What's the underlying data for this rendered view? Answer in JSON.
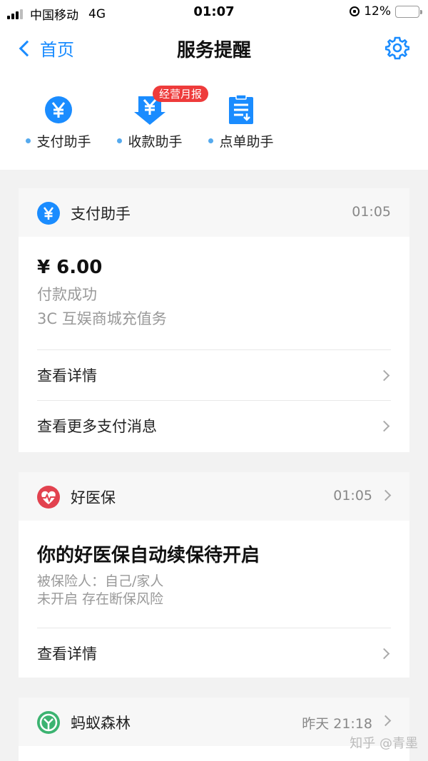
{
  "status_bar": {
    "carrier": "中国移动",
    "network": "4G",
    "time": "01:07",
    "battery": "12%"
  },
  "nav": {
    "back_label": "首页",
    "title": "服务提醒"
  },
  "quick_tabs": [
    {
      "label": "支付助手",
      "icon": "yen-circle-icon"
    },
    {
      "label": "收款助手",
      "icon": "yen-download-icon",
      "badge": "经营月报"
    },
    {
      "label": "点单助手",
      "icon": "order-list-icon"
    }
  ],
  "cards": {
    "payment": {
      "app_name": "支付助手",
      "time": "01:05",
      "amount": "¥ 6.00",
      "status": "付款成功",
      "merchant": "3C 互娱商城充值务",
      "rows": [
        "查看详情",
        "查看更多支付消息"
      ]
    },
    "insurance": {
      "app_name": "好医保",
      "time": "01:05",
      "headline": "你的好医保自动续保待开启",
      "insured": "被保险人：自己/家人",
      "risk": "未开启 存在断保风险",
      "rows": [
        "查看详情"
      ]
    },
    "forest": {
      "app_name": "蚂蚁森林",
      "time": "昨天 21:18"
    }
  },
  "watermark": "知乎 @青墨",
  "colors": {
    "accent_blue": "#1a8cff",
    "badge_red": "#ee3b3b",
    "health_red": "#e2424f",
    "forest_green": "#3cb371"
  }
}
